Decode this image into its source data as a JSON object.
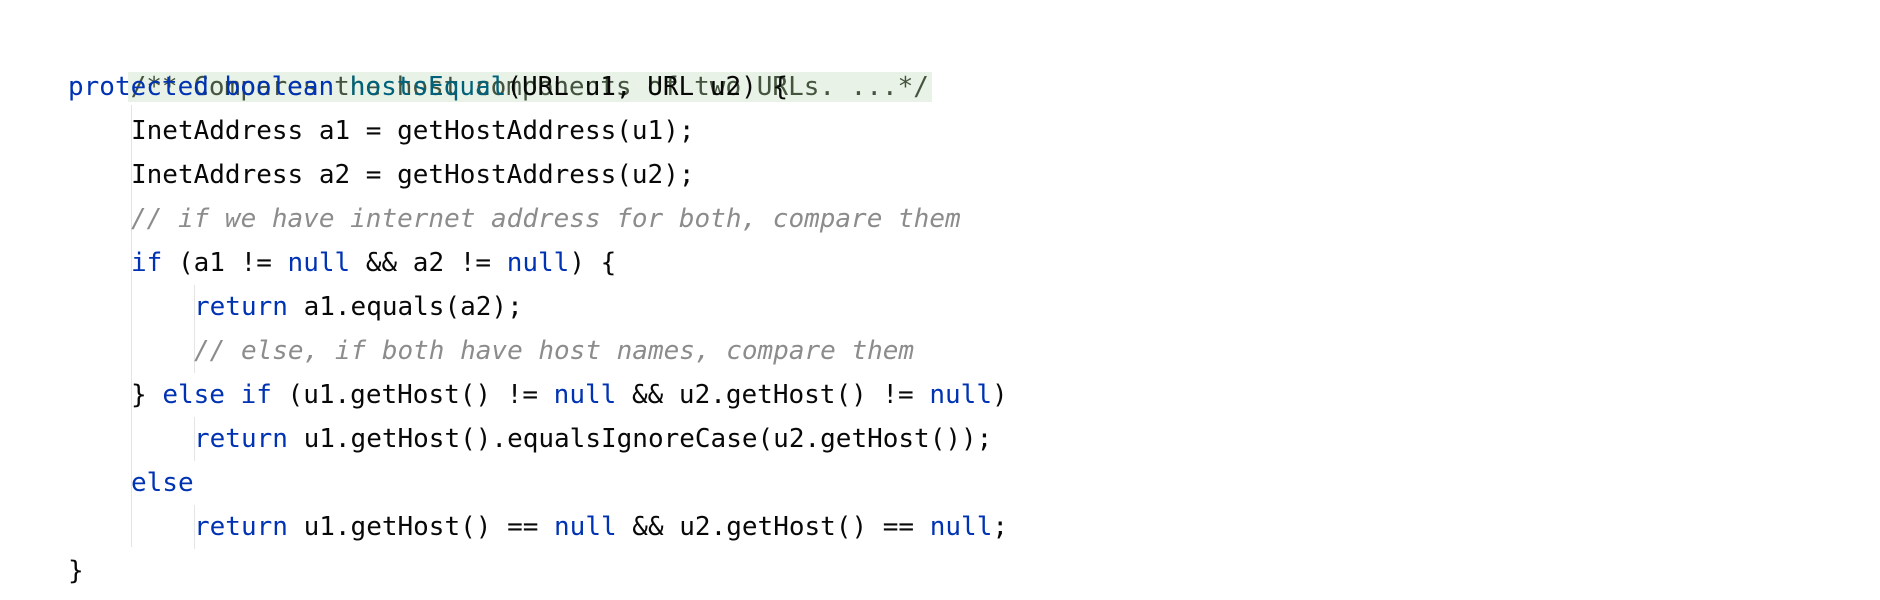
{
  "editor": {
    "doc_comment": "/** Compares the host components of two URLs. ...*/",
    "method_signature": {
      "modifier": "protected",
      "return_type": "boolean",
      "name": "hostsEqual",
      "params": "(URL u1, URL u2) {"
    },
    "lines": {
      "decl_a1": "InetAddress a1 = getHostAddress(u1);",
      "decl_a2": "InetAddress a2 = getHostAddress(u2);",
      "comment_both": "// if we have internet address for both, compare them",
      "if_kw": "if",
      "if_cond_1": " (a1 != ",
      "null_1": "null",
      "if_cond_2": " && a2 != ",
      "null_2": "null",
      "if_cond_3": ") {",
      "return_kw_1": "return",
      "return_expr_1": " a1.equals(a2);",
      "comment_else": "// else, if both have host names, compare them",
      "brace_close": "} ",
      "else_kw": "else",
      "space": " ",
      "if_kw_2": "if",
      "elif_cond_1": " (u1.getHost() != ",
      "null_3": "null",
      "elif_cond_2": " && u2.getHost() != ",
      "null_4": "null",
      "elif_cond_3": ")",
      "return_kw_2": "return",
      "return_expr_2": " u1.getHost().equalsIgnoreCase(u2.getHost());",
      "else_kw_2": "else",
      "return_kw_3": "return",
      "return_expr_3a": " u1.getHost() == ",
      "null_5": "null",
      "return_expr_3b": " && u2.getHost() == ",
      "null_6": "null",
      "return_expr_3c": ";",
      "method_close": "}"
    }
  },
  "colors": {
    "keyword": "#0033b3",
    "method_name": "#00627a",
    "comment": "#8c8c8c",
    "doc_fold_bg": "#e9f2e6",
    "text": "#080808"
  }
}
